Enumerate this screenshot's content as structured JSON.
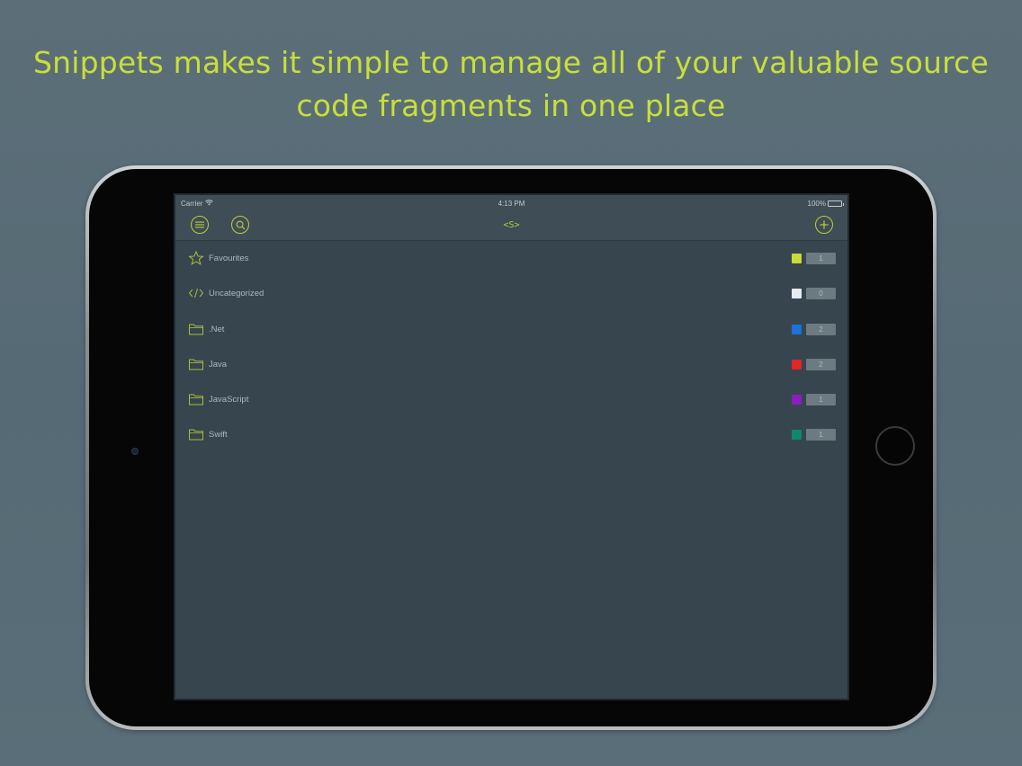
{
  "headline": {
    "line1": "Snippets makes it simple to manage all of your valuable source",
    "line2": "code fragments in one place"
  },
  "status_bar": {
    "carrier": "Carrier",
    "time": "4:13 PM",
    "battery": "100%"
  },
  "nav_bar": {
    "title": "<S>",
    "menu_icon": "menu-icon",
    "search_icon": "search-icon",
    "add_icon": "plus-icon"
  },
  "folders": [
    {
      "label": "Favourites",
      "icon": "star-icon",
      "color": "#c9d93a",
      "count": "1"
    },
    {
      "label": "Uncategorized",
      "icon": "code-icon",
      "color": "#e6ebee",
      "count": "0"
    },
    {
      "label": ".Net",
      "icon": "folder-icon",
      "color": "#1a73d9",
      "count": "2"
    },
    {
      "label": "Java",
      "icon": "folder-icon",
      "color": "#e02626",
      "count": "2"
    },
    {
      "label": "JavaScript",
      "icon": "folder-icon",
      "color": "#8a1fc0",
      "count": "1"
    },
    {
      "label": "Swift",
      "icon": "folder-icon",
      "color": "#0e8a6a",
      "count": "1"
    }
  ]
}
